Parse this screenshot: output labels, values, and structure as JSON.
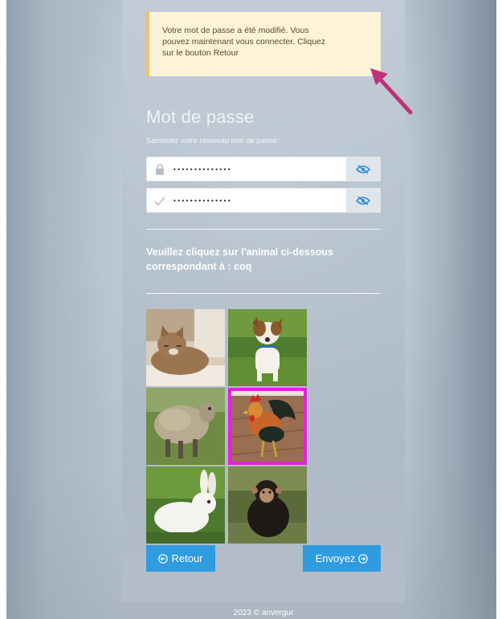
{
  "notice": {
    "line1": "Votre mot de passe a été modifié. Vous",
    "line2": "pouvez maintenant vous connecter. Cliquez",
    "line3": "sur le bouton Retour"
  },
  "form": {
    "title": "Mot de passe",
    "subtitle": "Saisissez votre nouveau mot de passe :",
    "password_value": "••••••••••••••",
    "confirm_value": "••••••••••••••"
  },
  "captcha": {
    "prompt_line1": "Veuillez cliquez sur l'animal ci-dessous",
    "prompt_line2_prefix": "correspondant à : ",
    "target_animal": "coq",
    "selected": "coq"
  },
  "buttons": {
    "back_label": "Retour",
    "submit_label": "Envoyez"
  },
  "footer": {
    "text": "2023 © anvergur"
  },
  "colors": {
    "accent": "#2f9be0",
    "selection": "#e81ee0",
    "notice_bg": "#fcf3d9",
    "annotation_arrow": "#c0307a"
  },
  "icons": {
    "lock": "lock-icon",
    "check": "check-icon",
    "eye_slash": "eye-slash-icon",
    "back_arrow": "circle-arrow-left-icon",
    "submit_arrow": "circle-arrow-right-icon"
  }
}
